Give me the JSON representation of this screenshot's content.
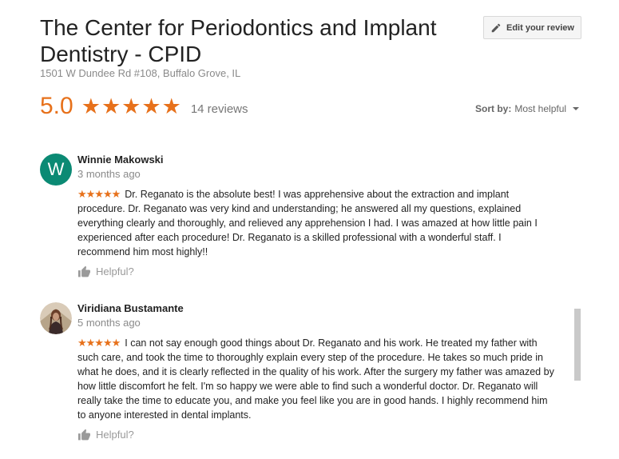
{
  "business": {
    "title": "The Center for Periodontics and Implant Dentistry - CPID",
    "address": "1501 W Dundee Rd #108, Buffalo Grove, IL"
  },
  "edit_button": {
    "label": "Edit your review",
    "icon": "pencil-icon"
  },
  "rating": {
    "value": "5.0",
    "stars": 5,
    "stars_display": "★★★★★",
    "count_label": "14 reviews"
  },
  "sort": {
    "label": "Sort by:",
    "value": "Most helpful"
  },
  "reviews": [
    {
      "avatar_letter": "W",
      "name": "Winnie Makowski",
      "date": "3 months ago",
      "stars_display": "★★★★★",
      "text": "Dr. Reganato is the absolute best! I was apprehensive about the extraction and implant procedure. Dr. Reganato was very kind and understanding;  he answered all my questions, explained everything clearly and thoroughly, and relieved any apprehension I had. I was amazed at how little pain I experienced after each procedure! Dr. Reganato is a skilled professional with a wonderful staff. I recommend him most highly!!",
      "helpful_label": "Helpful?"
    },
    {
      "name": "Viridiana Bustamante",
      "date": "5 months ago",
      "stars_display": "★★★★★",
      "text": "I can not say enough good things about Dr. Reganato and his work. He treated my father with such care, and took the time to thoroughly explain every step of the procedure. He takes so much pride in what he does, and it is clearly reflected in the quality of his work. After the surgery my father was amazed by how little discomfort he felt. I'm so happy we were able to find such a wonderful doctor. Dr. Reganato will really take the time to educate you, and make you feel like you are in good hands. I highly recommend him to anyone interested in dental implants.",
      "helpful_label": "Helpful?"
    }
  ],
  "colors": {
    "accent": "#e7711b",
    "avatar_bg": "#0b8a74",
    "muted_text": "#8a8a8a"
  }
}
